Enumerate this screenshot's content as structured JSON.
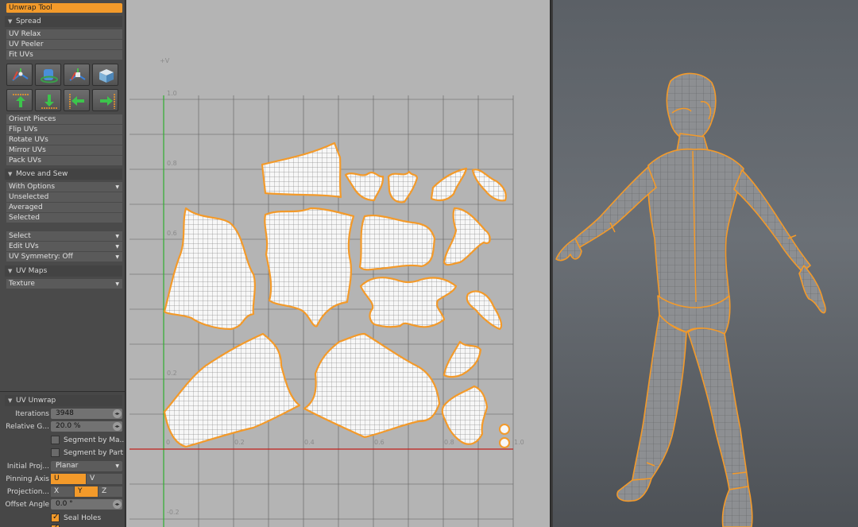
{
  "tool_panel": {
    "unwrap_tool": "Unwrap Tool",
    "spread_header": "Spread",
    "spread_items": [
      "UV Relax",
      "UV Peeler",
      "Fit UVs"
    ],
    "icon_row_1": [
      "move-uv-icon",
      "rotate-cylinder-icon",
      "scale-uv-icon",
      "box-project-icon"
    ],
    "icon_row_2": [
      "align-top-icon",
      "align-bottom-icon",
      "align-left-icon",
      "align-right-icon"
    ],
    "orient_items": [
      "Orient Pieces",
      "Flip UVs",
      "Rotate UVs",
      "Mirror UVs",
      "Pack UVs"
    ],
    "move_sew_header": "Move and Sew",
    "move_sew_dropdown": "With Options",
    "move_sew_items": [
      "Unselected",
      "Averaged",
      "Selected"
    ],
    "select_dropdown": "Select",
    "edit_uvs_dropdown": "Edit UVs",
    "uv_symmetry_dropdown": "UV Symmetry: Off",
    "uv_maps_header": "UV Maps",
    "texture_dropdown": "Texture"
  },
  "properties": {
    "header": "UV Unwrap",
    "iterations_label": "Iterations",
    "iterations_value": "3948",
    "relative_gap_label": "Relative G...",
    "relative_gap_value": "20.0 %",
    "segment_material_label": "Segment by Ma...",
    "segment_part_label": "Segment by Part",
    "initial_projection_label": "Initial Proj...",
    "initial_projection_value": "Planar",
    "pinning_axis_label": "Pinning Axis",
    "pinning_axis_u": "U",
    "pinning_axis_v": "V",
    "projection_axis_label": "Projection...",
    "projection_x": "X",
    "projection_y": "Y",
    "projection_z": "Z",
    "offset_angle_label": "Offset Angle",
    "offset_angle_value": "0.0 °",
    "seal_holes_label": "Seal Holes",
    "seal_holes_checked": true
  },
  "uv_viewport": {
    "axis_v_label": "+V",
    "y_ticks": [
      "1.0",
      "0.8",
      "0.6",
      "0.2",
      "-0.2"
    ],
    "x_ticks": [
      "0",
      "0.2",
      "0.4",
      "0.6",
      "0.8",
      "1.0"
    ],
    "accent_color": "#f39a2a",
    "u_axis_color": "#c0201c",
    "v_axis_color": "#2fae2f"
  },
  "viewport_3d": {
    "model": "humanoid-mesh-a-pose",
    "seam_color": "#f39a2a"
  }
}
